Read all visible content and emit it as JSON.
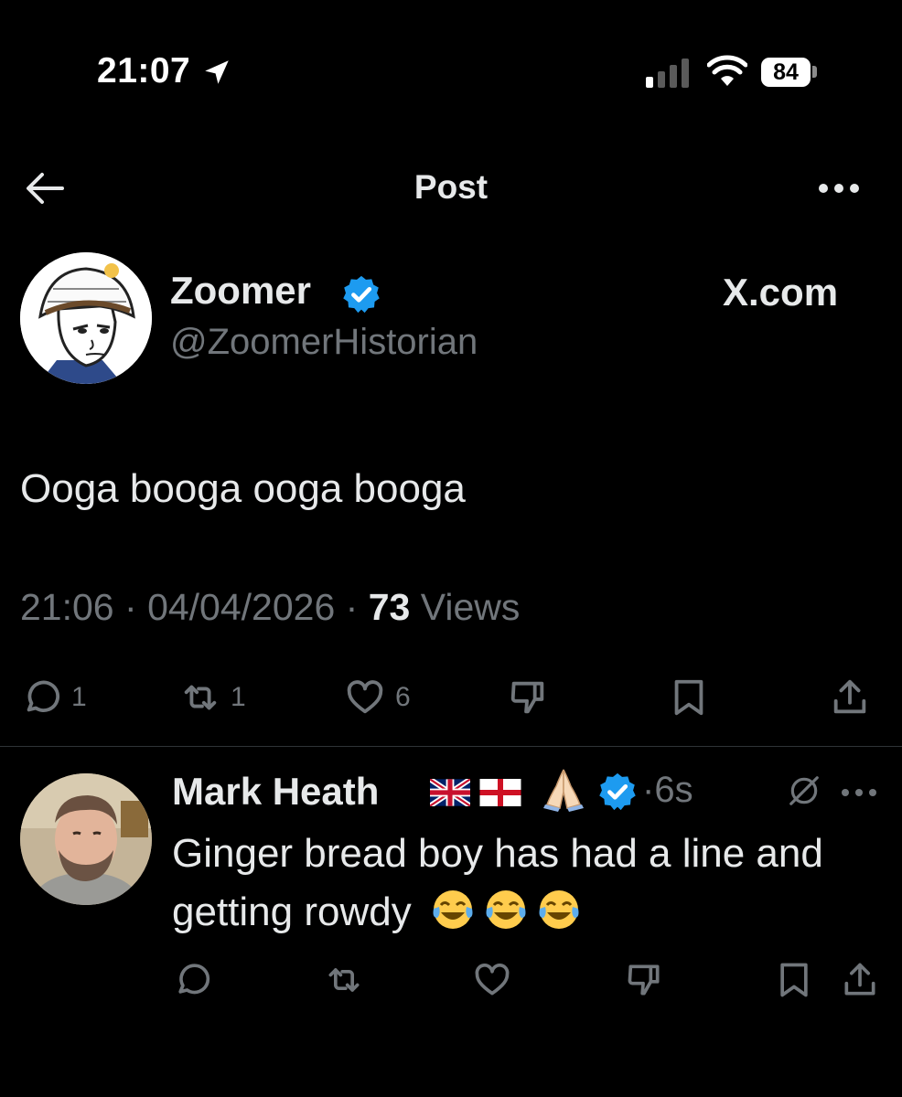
{
  "status_bar": {
    "time": "21:07",
    "battery": "84"
  },
  "header": {
    "title": "Post"
  },
  "post": {
    "author_name": "Zoomer",
    "author_handle": "@ZoomerHistorian",
    "source": "X.com",
    "text": "Ooga booga ooga booga",
    "time": "21:06",
    "date": "04/04/2026",
    "views_count": "73",
    "views_label": "Views",
    "replies": "1",
    "reposts": "1",
    "likes": "6"
  },
  "reply": {
    "author_name": "Mark Heath",
    "time": "6s",
    "text": "Ginger bread boy has had a line and getting rowdy"
  },
  "colors": {
    "background": "#000000",
    "text": "#e7e9ea",
    "muted": "#71767b",
    "verified": "#1d9bf0",
    "divider": "#2f3336"
  }
}
